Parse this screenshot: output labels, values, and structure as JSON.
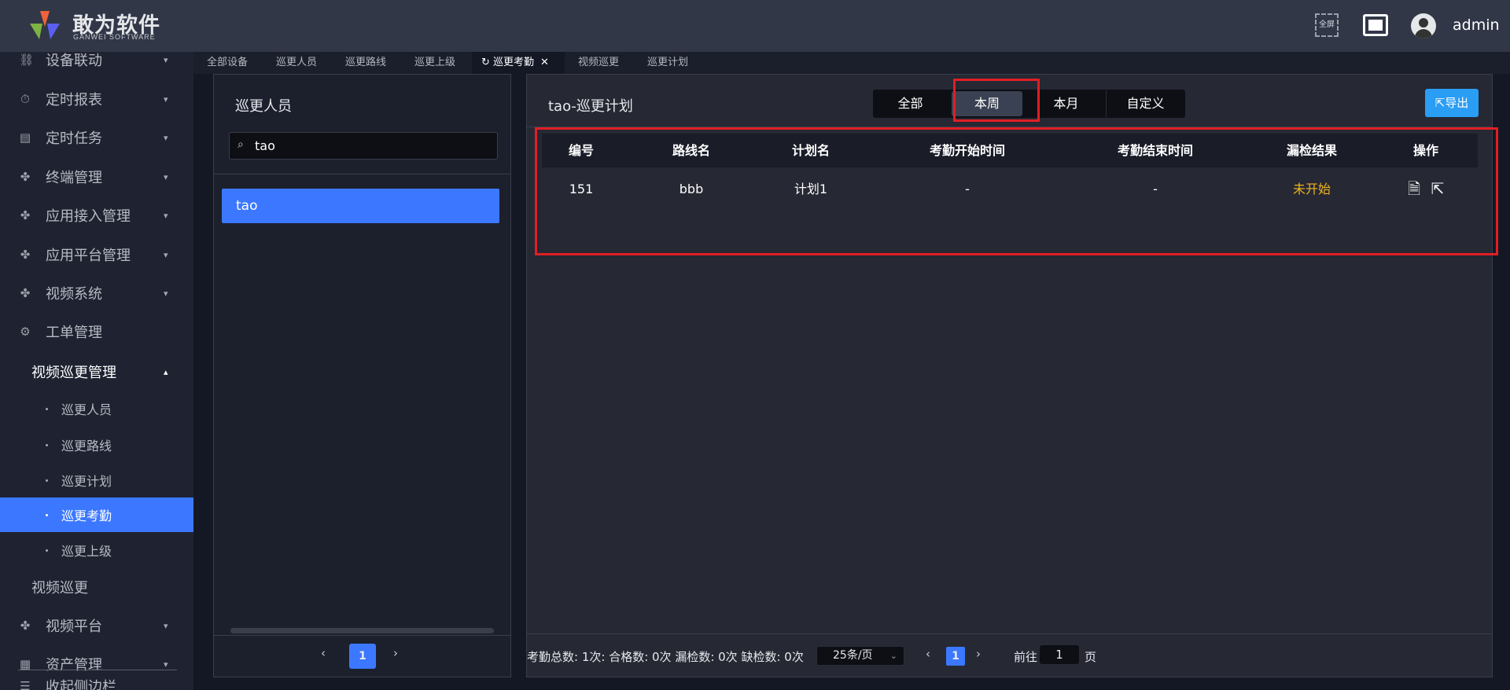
{
  "header": {
    "logo_text": "敢为软件",
    "logo_sub": "GANWEI SOFTWARE",
    "fullscreen_label": "全屏",
    "username": "admin"
  },
  "sidebar": {
    "items": [
      {
        "label": "设备联动",
        "icon": "link-icon",
        "expandable": true
      },
      {
        "label": "定时报表",
        "icon": "timer-icon",
        "expandable": true
      },
      {
        "label": "定时任务",
        "icon": "task-icon",
        "expandable": true
      },
      {
        "label": "终端管理",
        "icon": "grid-icon",
        "expandable": true
      },
      {
        "label": "应用接入管理",
        "icon": "grid-icon",
        "expandable": true
      },
      {
        "label": "应用平台管理",
        "icon": "grid-icon",
        "expandable": true
      },
      {
        "label": "视频系统",
        "icon": "grid-icon",
        "expandable": true
      },
      {
        "label": "工单管理",
        "icon": "gear-icon",
        "expandable": false
      },
      {
        "label": "视频巡更管理",
        "expanded": true
      }
    ],
    "sub_items": [
      "巡更人员",
      "巡更路线",
      "巡更计划",
      "巡更考勤",
      "巡更上级"
    ],
    "active_sub": "巡更考勤",
    "after_items": [
      {
        "label": "视频巡更"
      },
      {
        "label": "视频平台",
        "icon": "grid-icon"
      },
      {
        "label": "资产管理",
        "icon": "asset-icon"
      }
    ],
    "collapse_label": "收起侧边栏"
  },
  "tabs": [
    "全部设备",
    "巡更人员",
    "巡更路线",
    "巡更上级",
    "巡更考勤",
    "视频巡更",
    "巡更计划"
  ],
  "active_tab": "巡更考勤",
  "left_panel": {
    "title": "巡更人员",
    "search_value": "tao",
    "list": [
      "tao"
    ],
    "page": "1"
  },
  "right_panel": {
    "title": "tao-巡更计划",
    "filters": [
      "全部",
      "本周",
      "本月",
      "自定义"
    ],
    "active_filter": "本周",
    "export_label": "导出",
    "columns": [
      "编号",
      "路线名",
      "计划名",
      "考勤开始时间",
      "考勤结束时间",
      "漏检结果",
      "操作"
    ],
    "rows": [
      {
        "id": "151",
        "route": "bbb",
        "plan": "计划1",
        "start": "-",
        "end": "-",
        "result": "未开始"
      }
    ],
    "summary": "考勤总数: 1次: 合格数: 0次 漏检数: 0次 缺检数: 0次",
    "page_size": "25条/页",
    "page": "1",
    "goto_label": "前往",
    "goto_value": "1",
    "page_suffix": "页"
  },
  "colors": {
    "accent": "#3c78ff",
    "warning": "#f0b323",
    "highlight": "#e21e25"
  }
}
